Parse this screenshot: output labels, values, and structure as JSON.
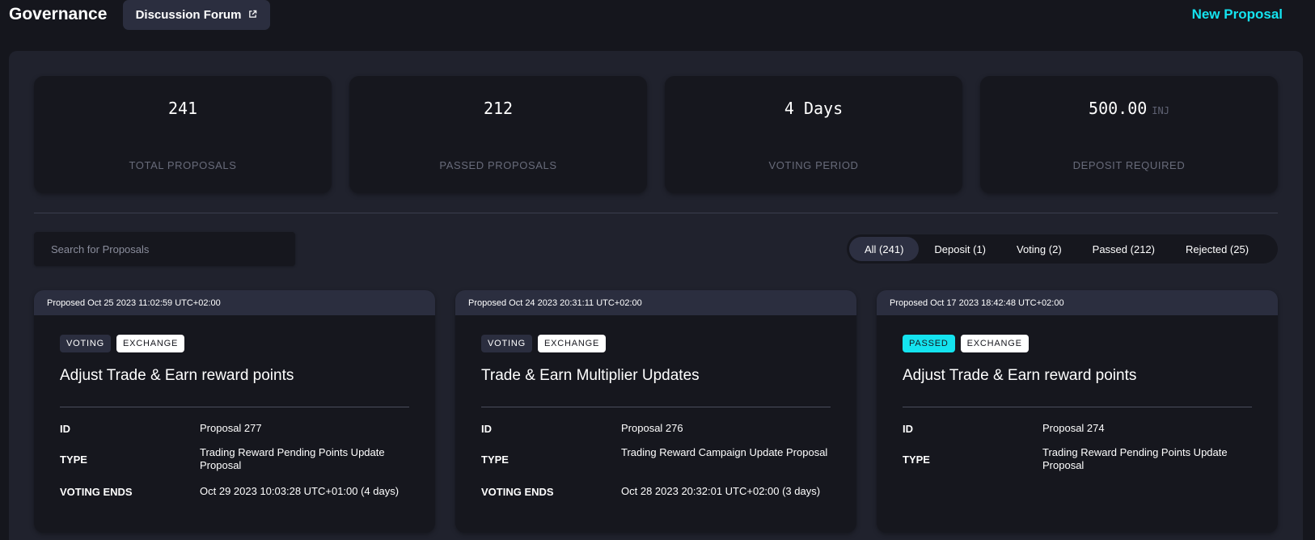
{
  "header": {
    "title": "Governance",
    "forum_button": "Discussion Forum",
    "forum_icon": "external-link-icon",
    "new_proposal": "New Proposal"
  },
  "colors": {
    "background": "#15161d",
    "panel": "#20222d",
    "card": "#16171e",
    "accent": "#14e3ef",
    "card_header": "#2b2e3f"
  },
  "stats": [
    {
      "value": "241",
      "unit": "",
      "label": "TOTAL PROPOSALS"
    },
    {
      "value": "212",
      "unit": "",
      "label": "PASSED PROPOSALS"
    },
    {
      "value": "4 Days",
      "unit": "",
      "label": "VOTING PERIOD"
    },
    {
      "value": "500.00",
      "unit": "INJ",
      "label": "DEPOSIT REQUIRED"
    }
  ],
  "search": {
    "placeholder": "Search for Proposals",
    "value": ""
  },
  "filters": [
    {
      "label": "All (241)",
      "active": true
    },
    {
      "label": "Deposit (1)",
      "active": false
    },
    {
      "label": "Voting (2)",
      "active": false
    },
    {
      "label": "Passed (212)",
      "active": false
    },
    {
      "label": "Rejected (25)",
      "active": false
    }
  ],
  "proposals": [
    {
      "proposed": "Proposed Oct 25 2023 11:02:59 UTC+02:00",
      "status": "VOTING",
      "category": "EXCHANGE",
      "title": "Adjust Trade & Earn reward points",
      "id_label": "ID",
      "id": "Proposal 277",
      "type_label": "TYPE",
      "type": "Trading Reward Pending Points Update Proposal",
      "ends_label": "VOTING ENDS",
      "ends": "Oct 29 2023 10:03:28 UTC+01:00 (4 days)"
    },
    {
      "proposed": "Proposed Oct 24 2023 20:31:11 UTC+02:00",
      "status": "VOTING",
      "category": "EXCHANGE",
      "title": "Trade & Earn Multiplier Updates",
      "id_label": "ID",
      "id": "Proposal 276",
      "type_label": "TYPE",
      "type": "Trading Reward Campaign Update Proposal",
      "ends_label": "VOTING ENDS",
      "ends": "Oct 28 2023 20:32:01 UTC+02:00 (3 days)"
    },
    {
      "proposed": "Proposed Oct 17 2023 18:42:48 UTC+02:00",
      "status": "PASSED",
      "category": "EXCHANGE",
      "title": "Adjust Trade & Earn reward points",
      "id_label": "ID",
      "id": "Proposal 274",
      "type_label": "TYPE",
      "type": "Trading Reward Pending Points Update Proposal"
    }
  ]
}
